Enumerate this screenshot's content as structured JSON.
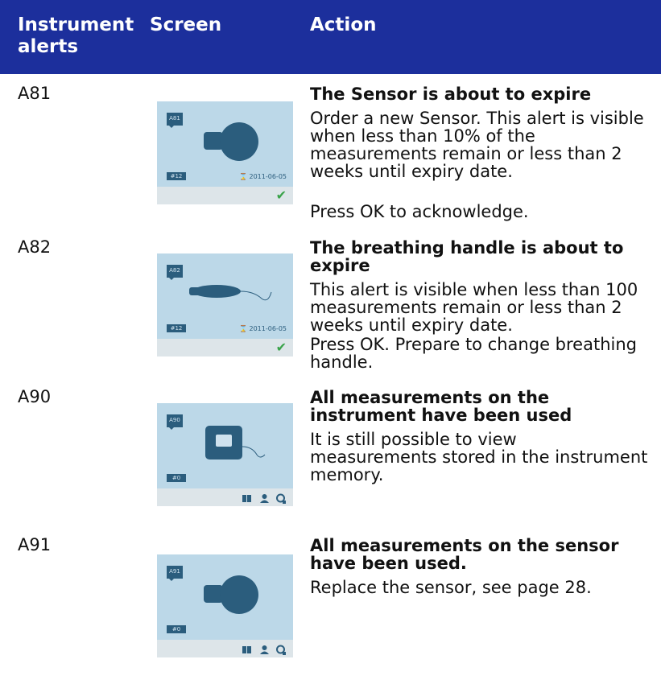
{
  "header": {
    "col1": "Instrument alerts",
    "col2": "Screen",
    "col3": "Action"
  },
  "rows": [
    {
      "code": "A81",
      "screen": {
        "tag": "A81",
        "count": "#12",
        "date": "⌛ 2011-06-05"
      },
      "title": "The Sensor is about to expire",
      "desc": "Order a new Sensor. This alert is visible when less than 10% of the measurements remain or less than 2 weeks until expiry date.",
      "note": "Press OK to acknowledge."
    },
    {
      "code": "A82",
      "screen": {
        "tag": "A82",
        "count": "#12",
        "date": "⌛ 2011-06-05"
      },
      "title": "The breathing handle is about to expire",
      "desc": "This alert is visible when less than 100 measurements remain or less than 2 weeks until expiry date.",
      "note": "Press OK. Prepare to change breathing handle."
    },
    {
      "code": "A90",
      "screen": {
        "tag": "A90",
        "count": "#0"
      },
      "title": "All measurements on the instrument have been used",
      "desc": "It is still possible to view measurements stored in the instrument memory."
    },
    {
      "code": "A91",
      "screen": {
        "tag": "A91",
        "count": "#0"
      },
      "title": "All measurements on the sensor have been used.",
      "desc": "Replace the sensor, see page 28."
    }
  ],
  "icons": {
    "confirm": "checkmark-icon",
    "log": "logbook-icon",
    "user": "user-icon",
    "settings": "settings-icon"
  },
  "colors": {
    "header_bg": "#1c2f9c",
    "screen_bg": "#bcd8e8",
    "device": "#2b5d7d",
    "check": "#3aa34a"
  }
}
